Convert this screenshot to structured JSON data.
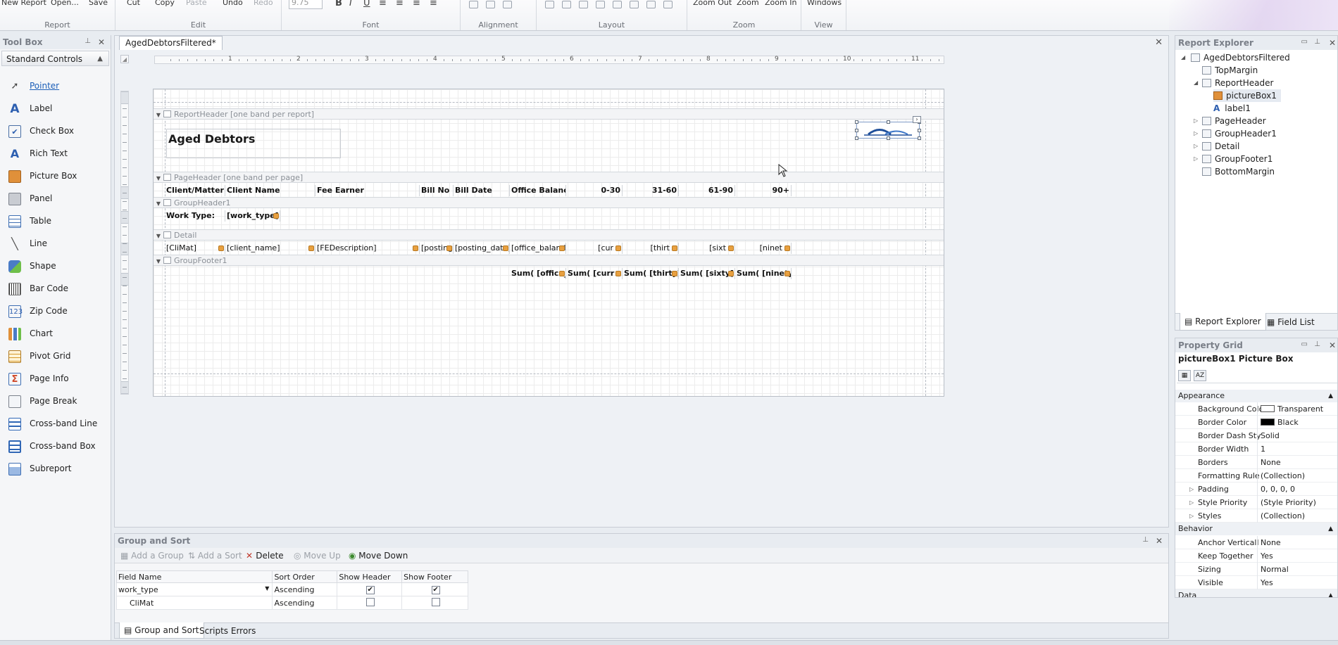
{
  "ribbon": {
    "report_buttons": [
      "New Report",
      "Open...",
      "Save"
    ],
    "edit_buttons": [
      "Cut",
      "Copy",
      "Paste",
      "Undo",
      "Redo"
    ],
    "font_size": "9.75",
    "zoom_buttons": [
      "Zoom Out",
      "Zoom",
      "Zoom In"
    ],
    "view_buttons": [
      "Windows"
    ],
    "groups": [
      "Report",
      "Edit",
      "Font",
      "Alignment",
      "Layout",
      "Zoom",
      "View"
    ]
  },
  "toolbox": {
    "title": "Tool Box",
    "category": "Standard Controls",
    "items": [
      "Pointer",
      "Label",
      "Check Box",
      "Rich Text",
      "Picture Box",
      "Panel",
      "Table",
      "Line",
      "Shape",
      "Bar Code",
      "Zip Code",
      "Chart",
      "Pivot Grid",
      "Page Info",
      "Page Break",
      "Cross-band Line",
      "Cross-band Box",
      "Subreport"
    ]
  },
  "document": {
    "tab_title": "AgedDebtorsFiltered*",
    "ruler_numbers": [
      "1",
      "2",
      "3",
      "4",
      "5",
      "6",
      "7",
      "8",
      "9",
      "10",
      "11"
    ],
    "report_title": "Aged Debtors",
    "bands": {
      "report_header": "ReportHeader [one band per report]",
      "page_header": "PageHeader [one band per page]",
      "group_header": "GroupHeader1",
      "detail": "Detail",
      "group_footer": "GroupFooter1"
    },
    "page_header_cells": [
      "Client/Matter No",
      "Client Name",
      "Fee Earner",
      "Bill No",
      "Bill Date",
      "Office Balance",
      "0-30",
      "31-60",
      "61-90",
      "90+"
    ],
    "group_header_cells": [
      "Work Type:",
      "[work_type]"
    ],
    "detail_cells": [
      "[CliMat]",
      "[client_name]",
      "[FEDescription]",
      "[posting",
      "[posting_date]",
      "[office_baland",
      "[cur",
      "[thirt",
      "[sixt",
      "[ninet"
    ],
    "footer_cells": [
      "Sum( [office_b",
      "Sum( [curr",
      "Sum( [thirty]",
      "Sum( [sixty]",
      "Sum( [ninety]"
    ]
  },
  "group_sort": {
    "title": "Group and Sort",
    "toolbar": {
      "add_group": "Add a Group",
      "add_sort": "Add a Sort",
      "delete": "Delete",
      "move_up": "Move Up",
      "move_down": "Move Down"
    },
    "columns": [
      "Field Name",
      "Sort Order",
      "Show Header",
      "Show Footer"
    ],
    "rows": [
      {
        "field": "work_type",
        "order": "Ascending",
        "header": true,
        "footer": true
      },
      {
        "field": "CliMat",
        "order": "Ascending",
        "header": false,
        "footer": false
      }
    ],
    "tabs": [
      "Group and Sort",
      "Scripts Errors"
    ]
  },
  "explorer": {
    "title": "Report Explorer",
    "nodes": [
      "AgedDebtorsFiltered",
      "TopMargin",
      "ReportHeader",
      "pictureBox1",
      "label1",
      "PageHeader",
      "GroupHeader1",
      "Detail",
      "GroupFooter1",
      "BottomMargin"
    ],
    "tabs": [
      "Report Explorer",
      "Field List"
    ]
  },
  "property_grid": {
    "title": "Property Grid",
    "selected": "pictureBox1  Picture Box",
    "categories": [
      "Appearance",
      "Behavior",
      "Data"
    ],
    "appearance": [
      {
        "name": "Background Colo",
        "value": "Transparent"
      },
      {
        "name": "Border Color",
        "value": "Black"
      },
      {
        "name": "Border Dash Sty",
        "value": "Solid"
      },
      {
        "name": "Border Width",
        "value": "1"
      },
      {
        "name": "Borders",
        "value": "None"
      },
      {
        "name": "Formatting Rule",
        "value": "(Collection)"
      },
      {
        "name": "Padding",
        "value": "0, 0, 0, 0"
      },
      {
        "name": "Style Priority",
        "value": "(Style Priority)"
      },
      {
        "name": "Styles",
        "value": "(Collection)"
      }
    ],
    "behavior": [
      {
        "name": "Anchor Verticall",
        "value": "None"
      },
      {
        "name": "Keep Together",
        "value": "Yes"
      },
      {
        "name": "Sizing",
        "value": "Normal"
      },
      {
        "name": "Visible",
        "value": "Yes"
      }
    ]
  }
}
